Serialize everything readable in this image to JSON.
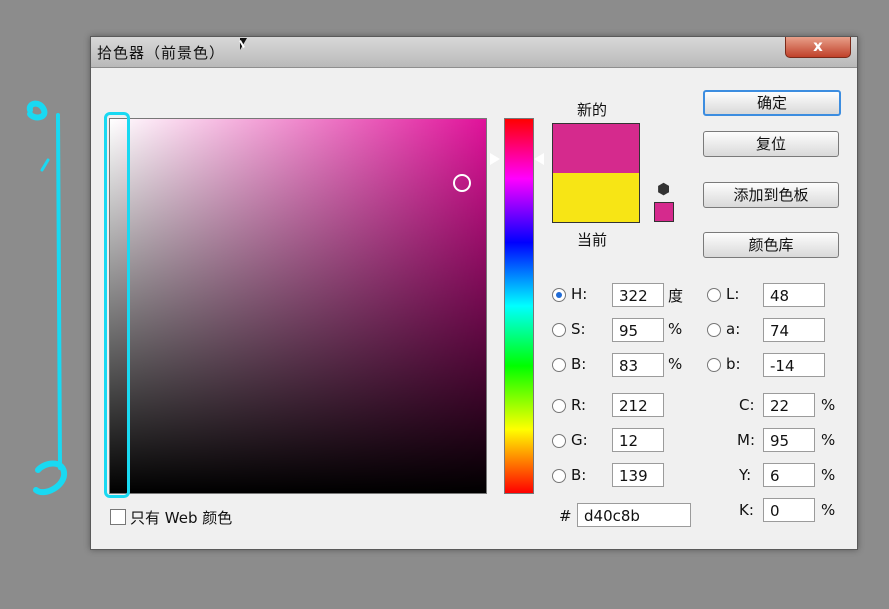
{
  "title": "拾色器（前景色）",
  "close_label": "x",
  "swatch": {
    "new_label": "新的",
    "current_label": "当前"
  },
  "buttons": {
    "ok": "确定",
    "reset": "复位",
    "add_to_swatches": "添加到色板",
    "color_library": "颜色库"
  },
  "hsb": {
    "h": {
      "label": "H:",
      "value": "322",
      "unit": "度"
    },
    "s": {
      "label": "S:",
      "value": "95",
      "unit": "%"
    },
    "b": {
      "label": "B:",
      "value": "83",
      "unit": "%"
    }
  },
  "lab": {
    "l": {
      "label": "L:",
      "value": "48"
    },
    "a": {
      "label": "a:",
      "value": "74"
    },
    "b": {
      "label": "b:",
      "value": "-14"
    }
  },
  "rgb": {
    "r": {
      "label": "R:",
      "value": "212"
    },
    "g": {
      "label": "G:",
      "value": "12"
    },
    "b": {
      "label": "B:",
      "value": "139"
    }
  },
  "cmyk": {
    "c": {
      "label": "C:",
      "value": "22",
      "unit": "%"
    },
    "m": {
      "label": "M:",
      "value": "95",
      "unit": "%"
    },
    "y": {
      "label": "Y:",
      "value": "6",
      "unit": "%"
    },
    "k": {
      "label": "K:",
      "value": "0",
      "unit": "%"
    }
  },
  "hex": {
    "label": "#",
    "value": "d40c8b"
  },
  "web_only": "只有 Web 颜色",
  "colors": {
    "new": "#d52a8d",
    "current": "#f7e515",
    "annotation": "#19d9f2"
  }
}
